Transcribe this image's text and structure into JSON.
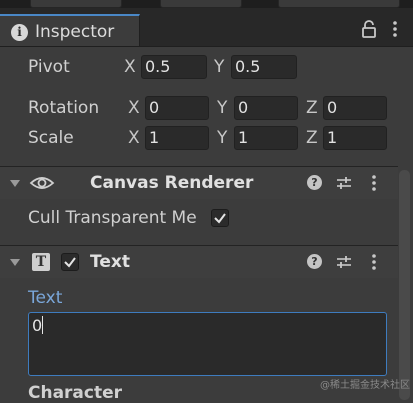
{
  "inspector": {
    "tab_title": "Inspector",
    "tab_icon": "info-icon",
    "lock_icon": "lock-icon",
    "menu_icon": "kebab-menu-icon"
  },
  "transform": {
    "pivot": {
      "label": "Pivot",
      "x_label": "X",
      "x": "0.5",
      "y_label": "Y",
      "y": "0.5"
    },
    "rotation": {
      "label": "Rotation",
      "x_label": "X",
      "x": "0",
      "y_label": "Y",
      "y": "0",
      "z_label": "Z",
      "z": "0"
    },
    "scale": {
      "label": "Scale",
      "x_label": "X",
      "x": "1",
      "y_label": "Y",
      "y": "1",
      "z_label": "Z",
      "z": "1"
    }
  },
  "canvas_renderer": {
    "title": "Canvas Renderer",
    "icon": "eye-icon",
    "cull_label": "Cull Transparent Me",
    "cull_checked": true,
    "help_icon": "help-icon",
    "preset_icon": "presets-icon",
    "menu_icon": "kebab-menu-icon"
  },
  "text_component": {
    "title": "Text",
    "icon": "text-t-icon",
    "enabled": true,
    "text_label": "Text",
    "text_value": "0",
    "character_label": "Character",
    "help_icon": "help-icon",
    "preset_icon": "presets-icon",
    "menu_icon": "kebab-menu-icon"
  },
  "watermark": "@稀土掘金技术社区",
  "colors": {
    "background": "#3c3c3c",
    "field": "#2a2a2a",
    "accent_blue": "#4a88c7",
    "label_highlight": "#7aa7da"
  }
}
